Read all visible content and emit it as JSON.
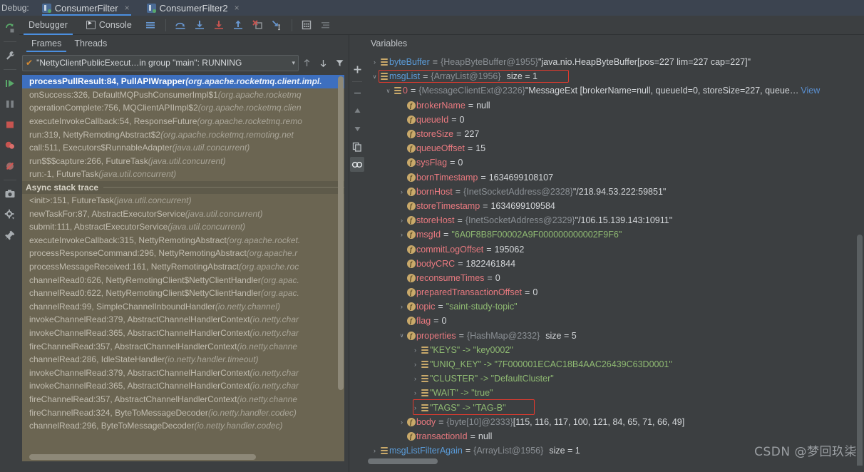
{
  "topbar": {
    "debug_label": "Debug:",
    "tabs": [
      {
        "label": "ConsumerFilter",
        "active": true,
        "close": "×"
      },
      {
        "label": "ConsumerFilter2",
        "active": false,
        "close": "×"
      }
    ]
  },
  "rail": {
    "icons": [
      "rerun-icon",
      "settings-wrench-icon",
      "resume-program-icon",
      "pause-program-icon",
      "stop-icon",
      "view-breakpoints-icon",
      "mute-breakpoints-icon",
      "camera-icon",
      "debugger-settings-icon",
      "pin-tab-icon"
    ]
  },
  "debug_toolbar": {
    "tabs": [
      {
        "label": "Debugger",
        "active": true
      },
      {
        "label": "Console",
        "active": false
      }
    ],
    "buttons": [
      "show-console-lines-icon",
      "step-over-icon",
      "step-into-icon",
      "force-step-into-icon",
      "step-out-icon",
      "drop-frame-icon",
      "run-to-cursor-icon",
      "evaluate-expression-icon",
      "layout-settings-icon"
    ]
  },
  "frames": {
    "tabs": [
      {
        "label": "Frames",
        "active": true
      },
      {
        "label": "Threads",
        "active": false
      }
    ],
    "thread_selector": {
      "check": "✔",
      "text": "\"NettyClientPublicExecut…in group \"main\": RUNNING",
      "caret": "▾"
    },
    "nav_icons": [
      "frame-up-icon",
      "frame-down-icon",
      "filter-frames-icon"
    ],
    "rows": [
      {
        "method": "processPullResult:84, PullAPIWrapper",
        "pkg": "(org.apache.rocketmq.client.impl.",
        "selected": true
      },
      {
        "method": "onSuccess:326, DefaultMQPushConsumerImpl$1",
        "pkg": "(org.apache.rocketmq",
        "selected": false
      },
      {
        "method": "operationComplete:756, MQClientAPIImpl$2",
        "pkg": "(org.apache.rocketmq.clien",
        "selected": false
      },
      {
        "method": "executeInvokeCallback:54, ResponseFuture",
        "pkg": "(org.apache.rocketmq.remo",
        "selected": false
      },
      {
        "method": "run:319, NettyRemotingAbstract$2",
        "pkg": "(org.apache.rocketmq.remoting.net",
        "selected": false
      },
      {
        "method": "call:511, Executors$RunnableAdapter",
        "pkg": "(java.util.concurrent)",
        "selected": false
      },
      {
        "method": "run$$$capture:266, FutureTask",
        "pkg": "(java.util.concurrent)",
        "selected": false
      },
      {
        "method": "run:-1, FutureTask",
        "pkg": "(java.util.concurrent)",
        "selected": false
      }
    ],
    "async_header": "Async stack trace",
    "async_rows": [
      {
        "method": "<init>:151, FutureTask",
        "pkg": "(java.util.concurrent)"
      },
      {
        "method": "newTaskFor:87, AbstractExecutorService",
        "pkg": "(java.util.concurrent)"
      },
      {
        "method": "submit:111, AbstractExecutorService",
        "pkg": "(java.util.concurrent)"
      },
      {
        "method": "executeInvokeCallback:315, NettyRemotingAbstract",
        "pkg": "(org.apache.rocket."
      },
      {
        "method": "processResponseCommand:296, NettyRemotingAbstract",
        "pkg": "(org.apache.r"
      },
      {
        "method": "processMessageReceived:161, NettyRemotingAbstract",
        "pkg": "(org.apache.roc"
      },
      {
        "method": "channelRead0:626, NettyRemotingClient$NettyClientHandler",
        "pkg": "(org.apac."
      },
      {
        "method": "channelRead0:622, NettyRemotingClient$NettyClientHandler",
        "pkg": "(org.apac."
      },
      {
        "method": "channelRead:99, SimpleChannelInboundHandler",
        "pkg": "(io.netty.channel)"
      },
      {
        "method": "invokeChannelRead:379, AbstractChannelHandlerContext",
        "pkg": "(io.netty.char"
      },
      {
        "method": "invokeChannelRead:365, AbstractChannelHandlerContext",
        "pkg": "(io.netty.char"
      },
      {
        "method": "fireChannelRead:357, AbstractChannelHandlerContext",
        "pkg": "(io.netty.channe"
      },
      {
        "method": "channelRead:286, IdleStateHandler",
        "pkg": "(io.netty.handler.timeout)"
      },
      {
        "method": "invokeChannelRead:379, AbstractChannelHandlerContext",
        "pkg": "(io.netty.char"
      },
      {
        "method": "invokeChannelRead:365, AbstractChannelHandlerContext",
        "pkg": "(io.netty.char"
      },
      {
        "method": "fireChannelRead:357, AbstractChannelHandlerContext",
        "pkg": "(io.netty.channe"
      },
      {
        "method": "fireChannelRead:324, ByteToMessageDecoder",
        "pkg": "(io.netty.handler.codec)"
      },
      {
        "method": "channelRead:296, ByteToMessageDecoder",
        "pkg": "(io.netty.handler.codec)"
      }
    ]
  },
  "mid_toolbar": {
    "icons": [
      "add-watch-icon",
      "remove-watch-icon",
      "move-up-icon",
      "move-down-icon",
      "copy-value-icon",
      "watches-icon"
    ]
  },
  "variables": {
    "title": "Variables",
    "rows": [
      {
        "indent": 0,
        "arrow": "›",
        "icon": "list",
        "name": "byteBuffer",
        "name_color": "blue",
        "eq": "=",
        "type": "{HeapByteBuffer@1955}",
        "value": "\"java.nio.HeapByteBuffer[pos=227 lim=227 cap=227]\"",
        "value_style": "plain"
      },
      {
        "indent": 0,
        "arrow": "⌄",
        "icon": "list",
        "name": "msgList",
        "name_color": "blue",
        "eq": "=",
        "type": "{ArrayList@1956}",
        "size": "size = 1",
        "highlight": true
      },
      {
        "indent": 1,
        "arrow": "⌄",
        "icon": "list",
        "name": "0",
        "name_color": "red",
        "eq": "=",
        "type": "{MessageClientExt@2326}",
        "value": "\"MessageExt [brokerName=null, queueId=0, storeSize=227, queue…",
        "value_style": "plain",
        "view": "View"
      },
      {
        "indent": 2,
        "arrow": "",
        "icon": "f",
        "name": "brokerName",
        "name_color": "pink",
        "eq": "=",
        "value": "null",
        "value_style": "plain"
      },
      {
        "indent": 2,
        "arrow": "",
        "icon": "f",
        "name": "queueId",
        "name_color": "pink",
        "eq": "=",
        "value": "0",
        "value_style": "num"
      },
      {
        "indent": 2,
        "arrow": "",
        "icon": "f",
        "name": "storeSize",
        "name_color": "pink",
        "eq": "=",
        "value": "227",
        "value_style": "num"
      },
      {
        "indent": 2,
        "arrow": "",
        "icon": "f",
        "name": "queueOffset",
        "name_color": "pink",
        "eq": "=",
        "value": "15",
        "value_style": "num"
      },
      {
        "indent": 2,
        "arrow": "",
        "icon": "f",
        "name": "sysFlag",
        "name_color": "pink",
        "eq": "=",
        "value": "0",
        "value_style": "num"
      },
      {
        "indent": 2,
        "arrow": "",
        "icon": "f",
        "name": "bornTimestamp",
        "name_color": "pink",
        "eq": "=",
        "value": "1634699108107",
        "value_style": "num"
      },
      {
        "indent": 2,
        "arrow": "›",
        "icon": "f",
        "name": "bornHost",
        "name_color": "pink",
        "eq": "=",
        "type": "{InetSocketAddress@2328}",
        "value": "\"/218.94.53.222:59851\"",
        "value_style": "plain"
      },
      {
        "indent": 2,
        "arrow": "",
        "icon": "f",
        "name": "storeTimestamp",
        "name_color": "pink",
        "eq": "=",
        "value": "1634699109584",
        "value_style": "num"
      },
      {
        "indent": 2,
        "arrow": "›",
        "icon": "f",
        "name": "storeHost",
        "name_color": "pink",
        "eq": "=",
        "type": "{InetSocketAddress@2329}",
        "value": "\"/106.15.139.143:10911\"",
        "value_style": "plain"
      },
      {
        "indent": 2,
        "arrow": "›",
        "icon": "f",
        "name": "msgId",
        "name_color": "pink",
        "eq": "=",
        "value": "\"6A0F8B8F00002A9F000000000002F9F6\"",
        "value_style": "str"
      },
      {
        "indent": 2,
        "arrow": "",
        "icon": "f",
        "name": "commitLogOffset",
        "name_color": "pink",
        "eq": "=",
        "value": "195062",
        "value_style": "num"
      },
      {
        "indent": 2,
        "arrow": "",
        "icon": "f",
        "name": "bodyCRC",
        "name_color": "pink",
        "eq": "=",
        "value": "1822461844",
        "value_style": "num"
      },
      {
        "indent": 2,
        "arrow": "",
        "icon": "f",
        "name": "reconsumeTimes",
        "name_color": "pink",
        "eq": "=",
        "value": "0",
        "value_style": "num"
      },
      {
        "indent": 2,
        "arrow": "",
        "icon": "f",
        "name": "preparedTransactionOffset",
        "name_color": "pink",
        "eq": "=",
        "value": "0",
        "value_style": "num"
      },
      {
        "indent": 2,
        "arrow": "›",
        "icon": "f",
        "name": "topic",
        "name_color": "pink",
        "eq": "=",
        "value": "\"saint-study-topic\"",
        "value_style": "str"
      },
      {
        "indent": 2,
        "arrow": "",
        "icon": "f",
        "name": "flag",
        "name_color": "pink",
        "eq": "=",
        "value": "0",
        "value_style": "num"
      },
      {
        "indent": 2,
        "arrow": "⌄",
        "icon": "f",
        "name": "properties",
        "name_color": "pink",
        "eq": "=",
        "type": "{HashMap@2332}",
        "size": "size = 5"
      },
      {
        "indent": 3,
        "arrow": "›",
        "icon": "list",
        "entry": "\"KEYS\" -> \"key0002\""
      },
      {
        "indent": 3,
        "arrow": "›",
        "icon": "list",
        "entry": "\"UNIQ_KEY\" -> \"7F000001ECAC18B4AAC26439C63D0001\""
      },
      {
        "indent": 3,
        "arrow": "›",
        "icon": "list",
        "entry": "\"CLUSTER\" -> \"DefaultCluster\""
      },
      {
        "indent": 3,
        "arrow": "›",
        "icon": "list",
        "entry": "\"WAIT\" -> \"true\""
      },
      {
        "indent": 3,
        "arrow": "›",
        "icon": "list",
        "entry": "\"TAGS\" -> \"TAG-B\"",
        "highlight2": true
      },
      {
        "indent": 2,
        "arrow": "›",
        "icon": "f",
        "name": "body",
        "name_color": "pink",
        "eq": "=",
        "type": "{byte[10]@2333}",
        "value": "[115, 116, 117, 100, 121, 84, 65, 71, 66, 49]",
        "value_style": "plain"
      },
      {
        "indent": 2,
        "arrow": "",
        "icon": "f",
        "name": "transactionId",
        "name_color": "pink",
        "eq": "=",
        "value": "null",
        "value_style": "plain"
      },
      {
        "indent": 0,
        "arrow": "›",
        "icon": "list",
        "name": "msgListFilterAgain",
        "name_color": "blue",
        "eq": "=",
        "type": "{ArrayList@1956}",
        "size": "size = 1"
      }
    ]
  },
  "watermark": "CSDN @梦回玖柒",
  "colors": {
    "accent_blue": "#4b8fe0",
    "selection_blue": "#3d6fbf",
    "frames_bg": "#6b6552",
    "panel_bg": "#3c3f41",
    "highlight_red": "#e23a2e",
    "field_icon": "#c9a96a",
    "string_green": "#8fba72",
    "name_pink": "#e8797f"
  }
}
